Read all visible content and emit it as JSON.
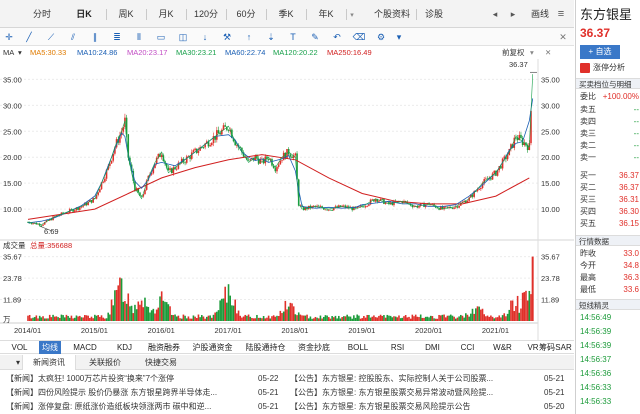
{
  "tabs": [
    {
      "label": "分时",
      "active": false
    },
    {
      "label": "日K",
      "active": true
    },
    {
      "label": "周K",
      "active": false
    },
    {
      "label": "月K",
      "active": false
    },
    {
      "label": "120分",
      "active": false
    },
    {
      "label": "60分",
      "active": false
    },
    {
      "label": "季K",
      "active": false
    },
    {
      "label": "年K",
      "active": false
    },
    {
      "label": "个股资料",
      "active": false
    },
    {
      "label": "诊股",
      "active": false
    },
    {
      "label": "画线",
      "active": false
    }
  ],
  "ma_line": {
    "prefix": "MA",
    "items": [
      {
        "label": "MA5:30.33",
        "color": "#e07b00"
      },
      {
        "label": "MA10:24.86",
        "color": "#1a5fb4"
      },
      {
        "label": "MA20:23.17",
        "color": "#c24cc4"
      },
      {
        "label": "MA30:23.21",
        "color": "#17a04a"
      },
      {
        "label": "MA60:22.74",
        "color": "#1a5fb4"
      },
      {
        "label": "MA120:20.22",
        "color": "#17a04a"
      },
      {
        "label": "MA250:16.49",
        "color": "#d11f1f"
      }
    ],
    "adjust_label": "前复权"
  },
  "chart_data": [
    {
      "type": "candlestick",
      "y_ticks": [
        "35.00",
        "30.00",
        "25.00",
        "20.00",
        "15.00",
        "10.00"
      ],
      "x_ticks": [
        "2014/01",
        "2015/01",
        "2016/01",
        "2017/01",
        "2018/01",
        "2019/01",
        "2020/01",
        "2021/01"
      ],
      "ylim": [
        5,
        37
      ],
      "annotations": {
        "high": "36.37",
        "low": "6.69"
      },
      "close_series": [
        [
          2014.0,
          7.5
        ],
        [
          2014.2,
          7.0
        ],
        [
          2014.4,
          8.5
        ],
        [
          2014.6,
          9.5
        ],
        [
          2014.8,
          10.5
        ],
        [
          2015.0,
          12
        ],
        [
          2015.1,
          15
        ],
        [
          2015.2,
          18
        ],
        [
          2015.3,
          22
        ],
        [
          2015.4,
          25
        ],
        [
          2015.45,
          27
        ],
        [
          2015.5,
          20
        ],
        [
          2015.6,
          14
        ],
        [
          2015.7,
          12
        ],
        [
          2015.8,
          16
        ],
        [
          2015.9,
          19
        ],
        [
          2016.0,
          21
        ],
        [
          2016.1,
          17
        ],
        [
          2016.2,
          18
        ],
        [
          2016.4,
          20
        ],
        [
          2016.6,
          22
        ],
        [
          2016.8,
          24
        ],
        [
          2017.0,
          26
        ],
        [
          2017.1,
          23
        ],
        [
          2017.2,
          21
        ],
        [
          2017.3,
          19
        ],
        [
          2017.4,
          20
        ],
        [
          2017.5,
          19
        ],
        [
          2017.6,
          20
        ],
        [
          2017.7,
          18
        ],
        [
          2017.8,
          20
        ],
        [
          2017.9,
          21
        ],
        [
          2018.0,
          20
        ],
        [
          2018.05,
          11
        ],
        [
          2018.1,
          10
        ],
        [
          2018.3,
          10.5
        ],
        [
          2018.5,
          10
        ],
        [
          2018.7,
          10.5
        ],
        [
          2018.9,
          10
        ],
        [
          2019.0,
          10.5
        ],
        [
          2019.2,
          12
        ],
        [
          2019.4,
          11
        ],
        [
          2019.6,
          11.5
        ],
        [
          2019.8,
          10.5
        ],
        [
          2020.0,
          11
        ],
        [
          2020.2,
          10
        ],
        [
          2020.4,
          10.5
        ],
        [
          2020.6,
          12
        ],
        [
          2020.8,
          15
        ],
        [
          2021.0,
          17
        ],
        [
          2021.1,
          19
        ],
        [
          2021.2,
          21
        ],
        [
          2021.3,
          24
        ],
        [
          2021.4,
          23
        ],
        [
          2021.5,
          22
        ],
        [
          2021.55,
          36
        ]
      ],
      "ma250_series": [
        [
          2014.0,
          8
        ],
        [
          2015.0,
          10
        ],
        [
          2015.5,
          13
        ],
        [
          2016.0,
          16
        ],
        [
          2016.5,
          18
        ],
        [
          2017.0,
          19.5
        ],
        [
          2017.5,
          20.5
        ],
        [
          2018.0,
          19.5
        ],
        [
          2018.5,
          16
        ],
        [
          2019.0,
          13
        ],
        [
          2019.5,
          11.5
        ],
        [
          2020.0,
          11
        ],
        [
          2020.5,
          11
        ],
        [
          2021.0,
          12.5
        ],
        [
          2021.5,
          16
        ]
      ]
    },
    {
      "type": "bar",
      "name": "volume",
      "label_prefix": "成交量",
      "total_label": "总量:356688",
      "y_ticks": [
        "35.67",
        "23.78",
        "11.89"
      ],
      "y_unit": "万",
      "ylim": [
        0,
        36
      ],
      "values_sample_peaks": [
        [
          2015.4,
          25
        ],
        [
          2015.7,
          18
        ],
        [
          2016.0,
          14
        ],
        [
          2017.0,
          20
        ],
        [
          2017.9,
          12
        ],
        [
          2020.7,
          10
        ],
        [
          2021.3,
          14
        ],
        [
          2021.55,
          35.67
        ]
      ]
    }
  ],
  "indicators": [
    "VOL",
    "均线",
    "MACD",
    "KDJ",
    "融资融券",
    "沪股通资金",
    "陆股通持仓",
    "资金抄底",
    "BOLL",
    "RSI",
    "DMI",
    "CCI",
    "W&R",
    "VR",
    "SAR",
    "筹码"
  ],
  "news_tabs": [
    "新闻资讯",
    "关联报价",
    "快捷交易"
  ],
  "news": [
    {
      "text": "【新闻】太疯狂! 1000万芯片投资“换来”7个涨停",
      "date": "05-22"
    },
    {
      "text": "【新闻】四份风险提示 股价仍暴涨 东方银星跨界半导体走...",
      "date": "05-21"
    },
    {
      "text": "【新闻】涨停复盘: 原纸涨价造纸板块领涨两市 碳中和逆...",
      "date": "05-21"
    }
  ],
  "notices": [
    {
      "text": "【公告】东方银星: 控股股东、实际控制人关于公司股票...",
      "date": "05-21"
    },
    {
      "text": "【公告】东方银星: 东方银星股票交易异常波动暨风险提...",
      "date": "05-21"
    },
    {
      "text": "【公告】东方银星: 东方银星股票交易风险提示公告",
      "date": "05-20"
    }
  ],
  "right_panel": {
    "stock_name": "东方银星",
    "price": "36.37",
    "add_button": "+ 自选",
    "limit_analysis": "涨停分析",
    "order_book_title": "买卖档位与明细",
    "ratio_label": "委比",
    "ratio_value": "+100.00%",
    "sells": [
      {
        "label": "卖五",
        "value": "--"
      },
      {
        "label": "卖四",
        "value": "--"
      },
      {
        "label": "卖三",
        "value": "--"
      },
      {
        "label": "卖二",
        "value": "--"
      },
      {
        "label": "卖一",
        "value": "--"
      }
    ],
    "buys": [
      {
        "label": "买一",
        "value": "36.37"
      },
      {
        "label": "买二",
        "value": "36.37"
      },
      {
        "label": "买三",
        "value": "36.31"
      },
      {
        "label": "买四",
        "value": "36.30"
      },
      {
        "label": "买五",
        "value": "36.15"
      }
    ],
    "market_title": "行情数据",
    "market": [
      {
        "label": "昨收",
        "value": "33.0"
      },
      {
        "label": "今开",
        "value": "34.8"
      },
      {
        "label": "最高",
        "value": "36.3"
      },
      {
        "label": "最低",
        "value": "33.6"
      }
    ],
    "ticks_title": "短线精灵",
    "ticks": [
      "14:56:49",
      "14:56:39",
      "14:56:39",
      "14:56:37",
      "14:56:36",
      "14:56:33",
      "14:56:33"
    ]
  },
  "colors": {
    "up": "#e0302a",
    "down": "#1c9b3a",
    "accent_blue": "#3a78c8"
  }
}
